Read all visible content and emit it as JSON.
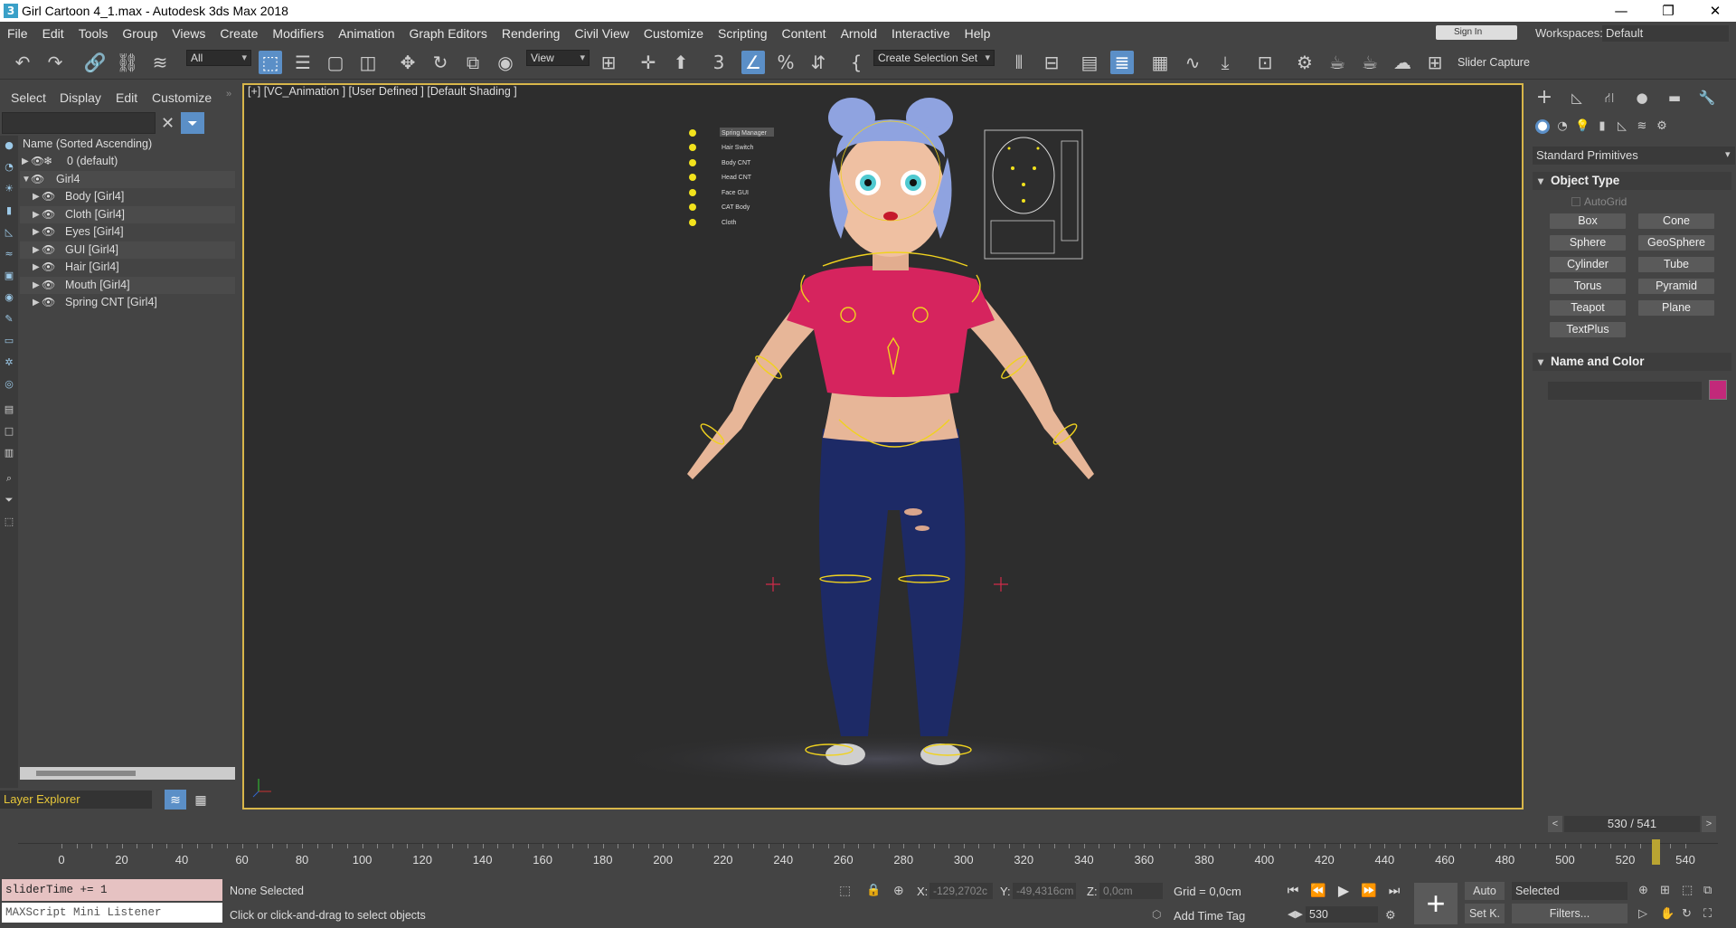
{
  "window": {
    "title": "Girl Cartoon 4_1.max - Autodesk 3ds Max 2018"
  },
  "menubar": {
    "items": [
      "File",
      "Edit",
      "Tools",
      "Group",
      "Views",
      "Create",
      "Modifiers",
      "Animation",
      "Graph Editors",
      "Rendering",
      "Civil View",
      "Customize",
      "Scripting",
      "Content",
      "Arnold",
      "Interactive",
      "Help"
    ],
    "signin": "Sign In",
    "workspaces_label": "Workspaces:",
    "workspace_value": "Default"
  },
  "toolbar": {
    "filter_value": "All",
    "ref_coord_value": "View",
    "selection_set_value": "Create Selection Set",
    "slider_capture": "Slider Capture"
  },
  "scene_explorer": {
    "tabs": [
      "Select",
      "Display",
      "Edit",
      "Customize"
    ],
    "header": "Name (Sorted Ascending)",
    "rows": [
      {
        "label": "0 (default)",
        "level": 0
      },
      {
        "label": "Girl4",
        "level": 0
      },
      {
        "label": "Body [Girl4]",
        "level": 1
      },
      {
        "label": "Cloth [Girl4]",
        "level": 1
      },
      {
        "label": "Eyes [Girl4]",
        "level": 1
      },
      {
        "label": "GUI [Girl4]",
        "level": 1
      },
      {
        "label": "Hair [Girl4]",
        "level": 1
      },
      {
        "label": "Mouth [Girl4]",
        "level": 1
      },
      {
        "label": "Spring CNT [Girl4]",
        "level": 1
      }
    ],
    "layer_explorer": "Layer Explorer"
  },
  "viewport": {
    "label": "[+] [VC_Animation ] [User Defined ] [Default Shading ]",
    "gui_items": [
      "Spring Manager",
      "Hair Switch",
      "Body CNT",
      "Head CNT",
      "Face GUI",
      "CAT Body",
      "Cloth"
    ]
  },
  "command_panel": {
    "category": "Standard Primitives",
    "object_type": "Object Type",
    "autogrid": "AutoGrid",
    "primitives": [
      "Box",
      "Cone",
      "Sphere",
      "GeoSphere",
      "Cylinder",
      "Tube",
      "Torus",
      "Pyramid",
      "Teapot",
      "Plane",
      "TextPlus"
    ],
    "name_and_color": "Name and Color",
    "object_color": "#c2297a"
  },
  "timeline": {
    "frame_indicator": "530 / 541",
    "current_frame": 530,
    "total_frames": 541,
    "ticks": [
      "0",
      "20",
      "40",
      "60",
      "80",
      "100",
      "120",
      "140",
      "160",
      "180",
      "200",
      "220",
      "240",
      "260",
      "280",
      "300",
      "320",
      "340",
      "360",
      "380",
      "400",
      "420",
      "440",
      "460",
      "480",
      "500",
      "520",
      "540"
    ]
  },
  "statusbar": {
    "maxscript_input": "sliderTime += 1",
    "maxscript_listener": "MAXScript Mini Listener",
    "selection_status": "None Selected",
    "prompt": "Click or click-and-drag to select objects",
    "x_label": "X:",
    "x_value": "-129,2702c",
    "y_label": "Y:",
    "y_value": "-49,4316cm",
    "z_label": "Z:",
    "z_value": "0,0cm",
    "grid": "Grid = 0,0cm",
    "add_time_tag": "Add Time Tag",
    "auto": "Auto",
    "set_key": "Set K.",
    "selected_dropdown": "Selected",
    "filters": "Filters...",
    "frame_spinner": "530"
  }
}
